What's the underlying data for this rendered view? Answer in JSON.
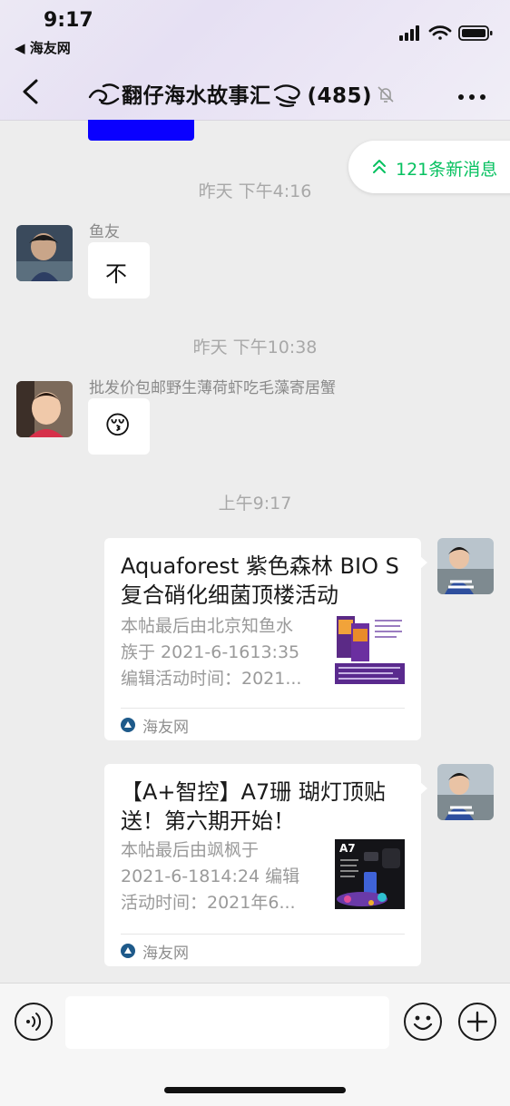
{
  "status_bar": {
    "time": "9:17",
    "back_app_label": "◀ 海友网"
  },
  "header": {
    "title": "翻仔海水故事汇",
    "member_count": "(485)",
    "icons": [
      "back-chevron-icon",
      "wave-icon",
      "mute-bell-icon",
      "more-icon"
    ]
  },
  "new_messages": "121条新消息",
  "messages": [
    {
      "timestamp": "昨天 下午4:16",
      "sender": "鱼友",
      "text": "不"
    },
    {
      "timestamp": "昨天 下午10:38",
      "sender": "批发价包邮野生薄荷虾吃毛藻寄居蟹",
      "emoji": "😚"
    },
    {
      "timestamp": "上午9:17"
    }
  ],
  "cards": [
    {
      "title_line1": "Aquaforest 紫色森林 BIO S",
      "title_line2": "复合硝化细菌顶楼活动",
      "desc_line1": "本帖最后由北京知鱼水",
      "desc_line2": "族于 2021-6-1613:35",
      "desc_line3": "编辑活动时间：2021...",
      "source": "海友网"
    },
    {
      "title_line1": "【A+智控】A7珊 瑚灯顶贴",
      "title_line2": "送！第六期开始！",
      "desc_line1": "本帖最后由飒枫于",
      "desc_line2": "2021-6-1814:24 编辑",
      "desc_line3": "活动时间：2021年6...",
      "source": "海友网",
      "thumb_label": "A7"
    }
  ],
  "colors": {
    "accent_green": "#07c160",
    "blue_block": "#0a00ff",
    "bg": "#ededed"
  }
}
